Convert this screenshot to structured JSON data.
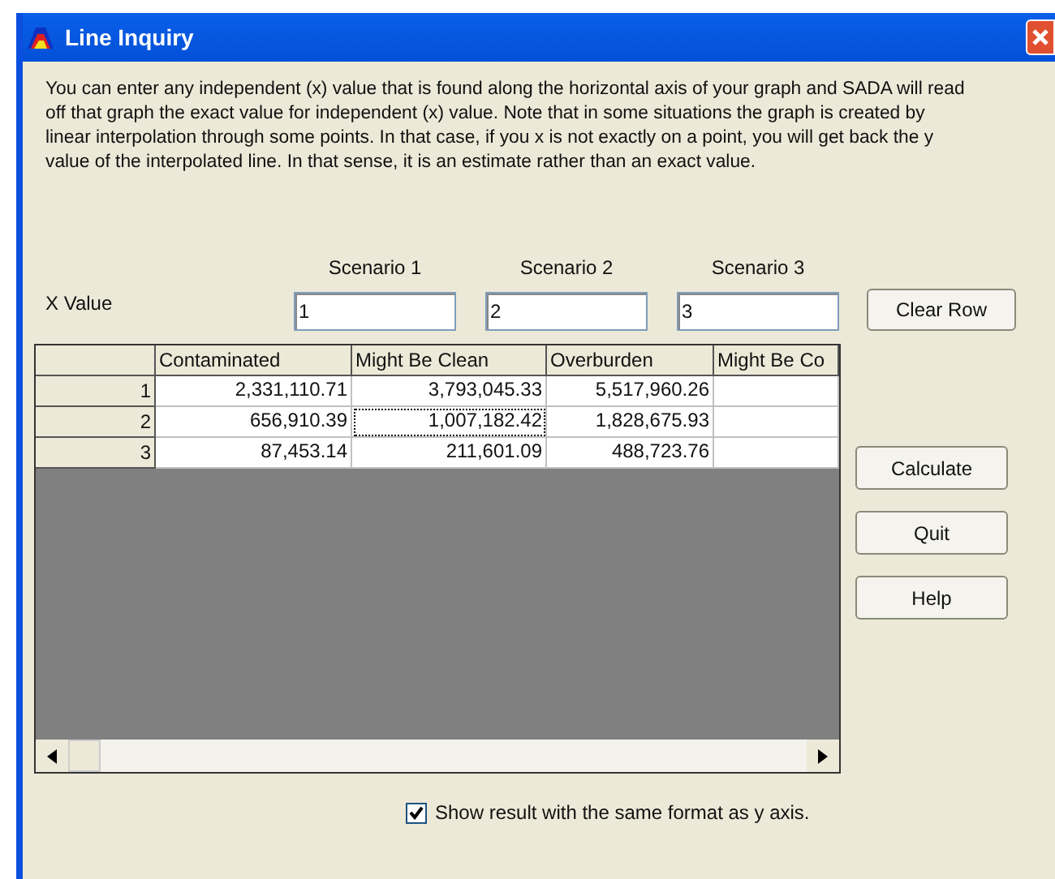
{
  "window": {
    "title": "Line Inquiry"
  },
  "description": "You can enter any independent (x)  value that is found along the horizontal axis of your graph and SADA will read off that graph the exact value for independent (x) value. Note that in some situations the graph is created by linear interpolation through some points. In that case, if you x is not exactly on a point, you will get back the y value of the interpolated line. In that sense, it is an estimate rather than an exact value.",
  "x_value_label": "X Value",
  "scenarios": [
    {
      "label": "Scenario 1",
      "value": "1"
    },
    {
      "label": "Scenario 2",
      "value": "2"
    },
    {
      "label": "Scenario 3",
      "value": "3"
    }
  ],
  "clear_row_button": "Clear Row",
  "table": {
    "columns": [
      "Contaminated",
      "Might Be Clean",
      "Overburden",
      "Might Be Co"
    ],
    "rows": [
      {
        "label": "1",
        "cells": [
          {
            "text": "2,331,110.71",
            "selected": false
          },
          {
            "text": "3,793,045.33",
            "selected": false
          },
          {
            "text": "5,517,960.26",
            "selected": false
          },
          {
            "text": "",
            "selected": false
          }
        ]
      },
      {
        "label": "2",
        "cells": [
          {
            "text": "656,910.39",
            "selected": false
          },
          {
            "text": "1,007,182.42",
            "selected": true
          },
          {
            "text": "1,828,675.93",
            "selected": false
          },
          {
            "text": "",
            "selected": false
          }
        ]
      },
      {
        "label": "3",
        "cells": [
          {
            "text": "87,453.14",
            "selected": false
          },
          {
            "text": "211,601.09",
            "selected": false
          },
          {
            "text": "488,723.76",
            "selected": false
          },
          {
            "text": "",
            "selected": false
          }
        ]
      }
    ]
  },
  "buttons": [
    "Calculate",
    "Quit",
    "Help"
  ],
  "format_checkbox": {
    "label": "Show result with the same format as y axis.",
    "checked": true
  }
}
